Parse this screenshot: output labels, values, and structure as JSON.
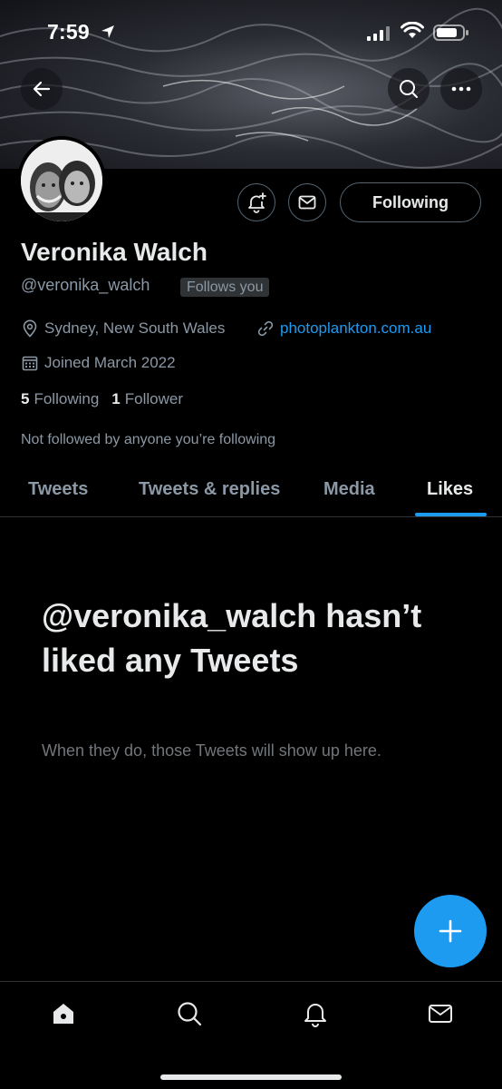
{
  "status_bar": {
    "time": "7:59"
  },
  "profile": {
    "display_name": "Veronika Walch",
    "handle": "@veronika_walch",
    "follows_you_badge": "Follows you",
    "location": "Sydney, New South Wales",
    "website": "photoplankton.com.au",
    "joined": "Joined March 2022",
    "following_count": "5",
    "following_label": "Following",
    "followers_count": "1",
    "followers_label": "Follower",
    "not_followed_note": "Not followed by anyone you’re following"
  },
  "actions": {
    "following_button_label": "Following"
  },
  "tabs": [
    {
      "label": "Tweets",
      "active": false
    },
    {
      "label": "Tweets & replies",
      "active": false
    },
    {
      "label": "Media",
      "active": false
    },
    {
      "label": "Likes",
      "active": true
    }
  ],
  "empty_state": {
    "title": "@veronika_walch hasn’t liked any Tweets",
    "subtitle": "When they do, those Tweets will show up here."
  },
  "icons": {
    "back": "arrow-left-icon",
    "search_top": "search-icon",
    "more": "more-horizontal-icon",
    "notify": "bell-plus-icon",
    "message": "envelope-icon",
    "location": "location-pin-icon",
    "website": "link-icon",
    "joined": "calendar-icon",
    "compose": "plus-icon",
    "nav_home": "home-icon",
    "nav_search": "search-icon",
    "nav_notifications": "bell-icon",
    "nav_messages": "envelope-icon"
  },
  "colors": {
    "accent": "#1d9bf0",
    "background": "#000000",
    "text_primary": "#e7e9ea",
    "text_secondary": "#8b98a5",
    "divider": "#2f3336"
  }
}
